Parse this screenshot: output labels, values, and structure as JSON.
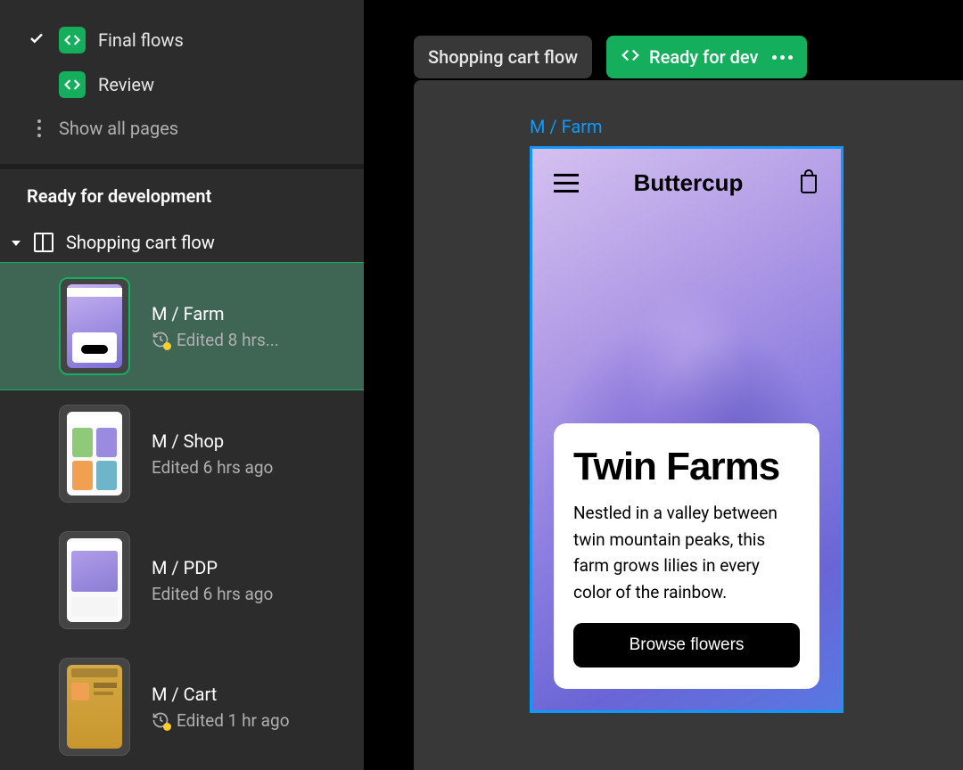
{
  "sidebar": {
    "pages": [
      {
        "label": "Final flows",
        "checked": true
      },
      {
        "label": "Review",
        "checked": false
      }
    ],
    "show_all_label": "Show all pages",
    "section_title": "Ready for development",
    "frame_group": "Shopping cart flow",
    "layers": [
      {
        "name": "M / Farm",
        "meta": "Edited 8 hrs...",
        "has_history_badge": true,
        "selected": true,
        "thumb": "farm"
      },
      {
        "name": "M / Shop",
        "meta": "Edited 6 hrs ago",
        "has_history_badge": false,
        "selected": false,
        "thumb": "shop"
      },
      {
        "name": "M / PDP",
        "meta": "Edited 6 hrs ago",
        "has_history_badge": false,
        "selected": false,
        "thumb": "pdp"
      },
      {
        "name": "M / Cart",
        "meta": "Edited 1 hr ago",
        "has_history_badge": true,
        "selected": false,
        "thumb": "cart"
      }
    ]
  },
  "canvas": {
    "tag_section": "Shopping cart flow",
    "tag_status": "Ready for dev",
    "frame_label": "M / Farm",
    "device": {
      "brand": "Buttercup",
      "hero_title": "Twin Farms",
      "hero_body": "Nestled in a valley between twin mountain peaks, this farm grows lilies in every color of the rainbow.",
      "cta_label": "Browse flowers"
    }
  },
  "colors": {
    "green": "#14ae5c",
    "selection_blue": "#0d99ff",
    "history_dot": "#ffcd29"
  }
}
